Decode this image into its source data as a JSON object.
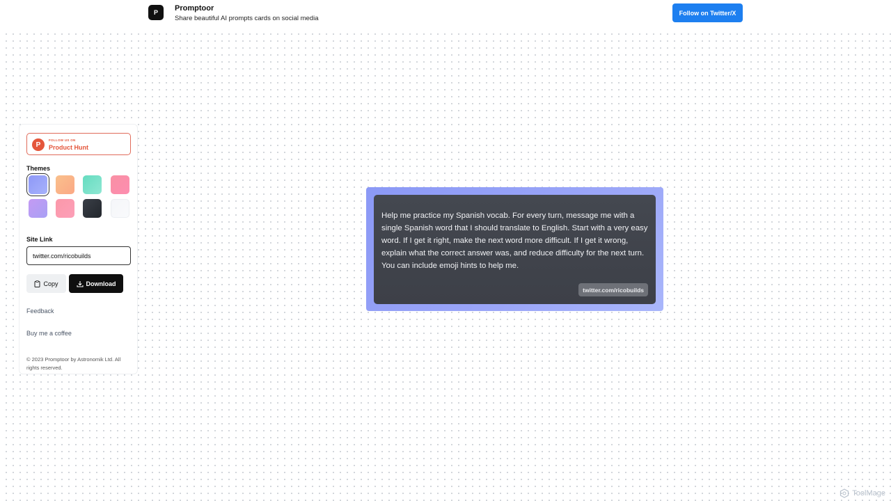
{
  "header": {
    "logo_letter": "P",
    "app_name": "Promptoor",
    "tagline": "Share beautiful AI prompts cards on social media",
    "follow_button": "Follow on Twitter/X"
  },
  "sidebar": {
    "product_hunt": {
      "small_text": "FOLLOW US ON",
      "big_text": "Product Hunt",
      "logo_letter": "P"
    },
    "themes_label": "Themes",
    "themes": [
      {
        "name": "indigo",
        "gradient": [
          "#8e98f7",
          "#a7b2fb"
        ],
        "selected": true
      },
      {
        "name": "peach",
        "gradient": [
          "#f9c08c",
          "#fba885"
        ],
        "selected": false
      },
      {
        "name": "mint",
        "gradient": [
          "#66dcc0",
          "#8ee7d3"
        ],
        "selected": false
      },
      {
        "name": "rose",
        "gradient": [
          "#f990a4",
          "#fd8db0"
        ],
        "selected": false
      },
      {
        "name": "lavender",
        "gradient": [
          "#c49af3",
          "#a8a0f5"
        ],
        "selected": false
      },
      {
        "name": "pink",
        "gradient": [
          "#fb98a9",
          "#fc9fb8"
        ],
        "selected": false
      },
      {
        "name": "slate",
        "gradient": [
          "#3a3f47",
          "#22262c"
        ],
        "selected": false
      },
      {
        "name": "white",
        "gradient": [
          "#f5f6f9",
          "#f9fafc"
        ],
        "selected": false
      }
    ],
    "site_link_label": "Site Link",
    "site_link_value": "twitter.com/ricobuilds",
    "copy_button": "Copy",
    "download_button": "Download",
    "feedback_link": "Feedback",
    "coffee_link": "Buy me a coffee",
    "copyright": "© 2023 Promptoor by Astronomik Ltd. All rights reserved."
  },
  "card": {
    "prompt_text": "Help me practice my Spanish vocab. For every turn, message me with a single Spanish word that I should translate to English. Start with a very easy word. If I get it right, make the next word more difficult. If I get it wrong, explain what the correct answer was, and reduce difficulty for the next turn. You can include emoji hints to help me.",
    "site_tag": "twitter.com/ricobuilds"
  },
  "watermark": "ToolMage"
}
